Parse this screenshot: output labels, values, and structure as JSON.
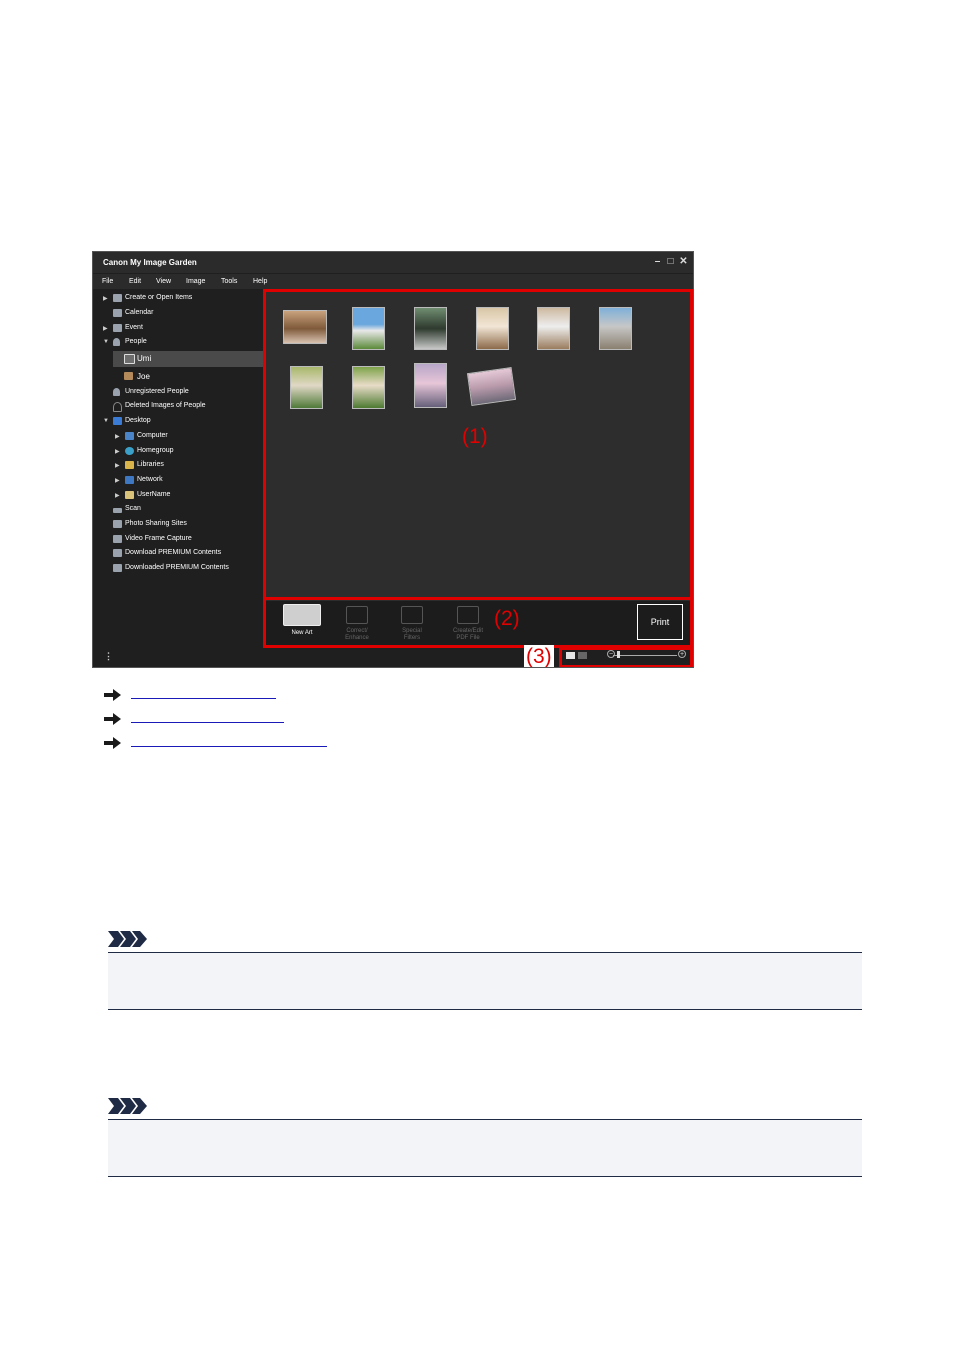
{
  "window": {
    "title": "Canon My Image Garden",
    "controls": [
      "minimize-icon",
      "maximize-icon",
      "close-icon"
    ]
  },
  "menu": [
    "File",
    "Edit",
    "View",
    "Image",
    "Tools",
    "Help"
  ],
  "sidebar": {
    "items": [
      {
        "label": "Create or Open Items",
        "expandable": true
      },
      {
        "label": "Calendar",
        "expandable": false
      },
      {
        "label": "Event",
        "expandable": true
      },
      {
        "label": "People",
        "expandable": true,
        "expanded": true
      },
      {
        "label": "Umi",
        "selected": true
      },
      {
        "label": "Joe"
      },
      {
        "label": "Unregistered People"
      },
      {
        "label": "Deleted Images of People"
      },
      {
        "label": "Desktop",
        "expandable": true,
        "expanded": true
      },
      {
        "label": "Computer",
        "expandable": true
      },
      {
        "label": "Homegroup",
        "expandable": true
      },
      {
        "label": "Libraries",
        "expandable": true
      },
      {
        "label": "Network",
        "expandable": true
      },
      {
        "label": "UserName",
        "expandable": true
      },
      {
        "label": "Scan"
      },
      {
        "label": "Photo Sharing Sites"
      },
      {
        "label": "Video Frame Capture"
      },
      {
        "label": "Download PREMIUM Contents"
      },
      {
        "label": "Downloaded PREMIUM Contents"
      }
    ]
  },
  "callouts": {
    "area1": "(1)",
    "area2": "(2)",
    "area3": "(3)"
  },
  "toolbar": {
    "new_art": "New Art",
    "correct_enhance_1": "Correct/",
    "correct_enhance_2": "Enhance",
    "special_filters_1": "Special",
    "special_filters_2": "Filters",
    "create_pdf_1": "Create/Edit",
    "create_pdf_2": "PDF File",
    "print": "Print"
  },
  "colors": {
    "highlight": "#e00000",
    "link": "#1a1ab8",
    "note_bg": "#f3f4f8",
    "note_chevron": "#1f2a44"
  }
}
